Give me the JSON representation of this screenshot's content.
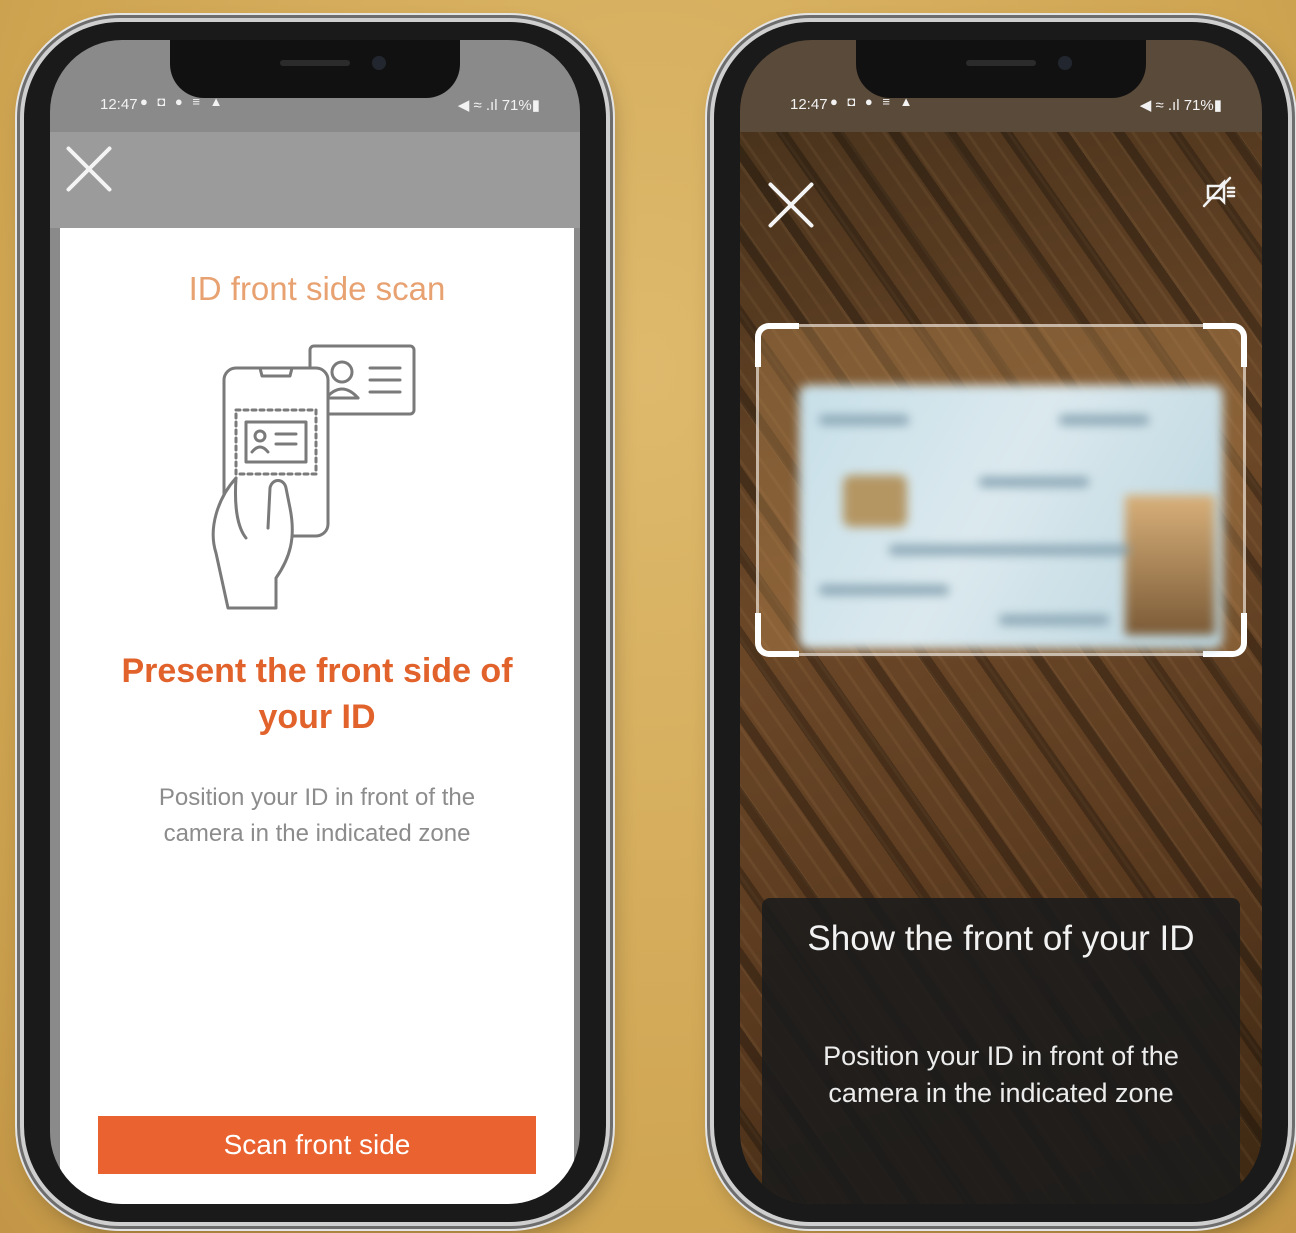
{
  "status_bar": {
    "time": "12:47",
    "left_icons": "● ◘ ● ≡ ▲",
    "right": "◀ ≈ .ıl 71%▮"
  },
  "left_screen": {
    "title": "ID front side scan",
    "headline": "Present the front side of your ID",
    "subtext": "Position your ID in front of the camera in the indicated zone",
    "button_label": "Scan front side"
  },
  "right_screen": {
    "headline": "Show the front of your ID",
    "instructions": "Position your ID in front of the camera in the indicated zone"
  },
  "colors": {
    "accent": "#e9622f",
    "title": "#e8a170",
    "background": "#d4ac5e"
  },
  "icons": [
    "close-icon",
    "flash-off-icon",
    "id-scan-illustration-icon"
  ]
}
